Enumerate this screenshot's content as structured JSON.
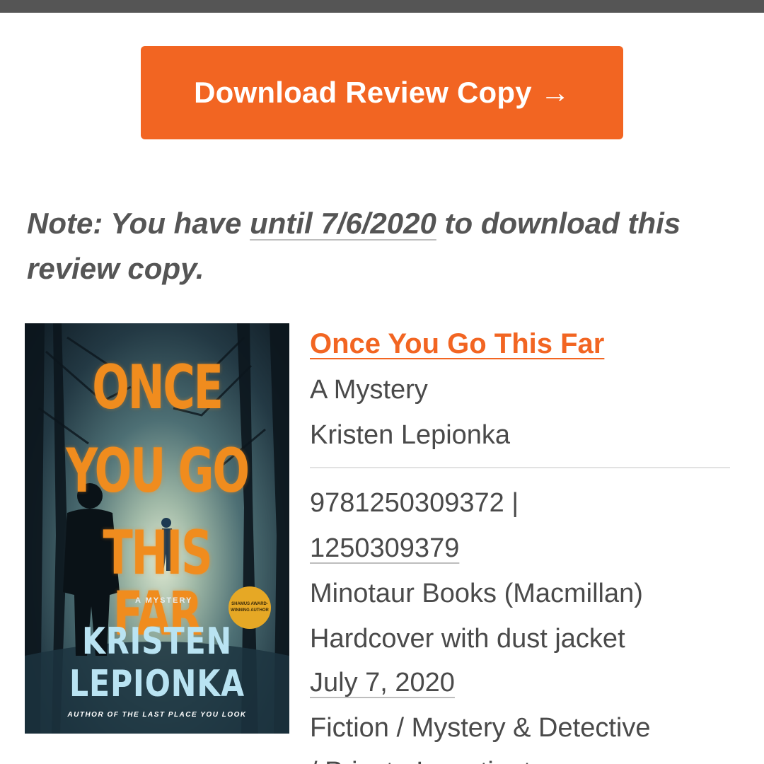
{
  "download_button": {
    "label": "Download Review Copy →"
  },
  "note": {
    "prefix": "Note: You have ",
    "deadline": "until 7/6/2020",
    "suffix": " to download this review copy."
  },
  "cover": {
    "title_line_1": "ONCE",
    "title_line_2": "YOU GO",
    "title_line_3": "THIS FAR",
    "subtitle": "A MYSTERY",
    "badge": "SHAMUS AWARD-WINNING AUTHOR",
    "author_line_1": "KRISTEN",
    "author_line_2": "LEPIONKA",
    "tagline": "AUTHOR OF THE LAST PLACE YOU LOOK"
  },
  "book": {
    "title": "Once You Go This Far",
    "subtitle": "A Mystery",
    "author": "Kristen Lepionka",
    "isbn13": "9781250309372 |",
    "isbn10": "1250309379",
    "publisher": "Minotaur Books (Macmillan)",
    "format": "Hardcover with dust jacket",
    "pub_date": "July 7, 2020",
    "category": "Fiction / Mystery & Detective",
    "category_cont": "/ Private Investigators"
  },
  "colors": {
    "accent": "#f26522",
    "text": "#4a4a4a",
    "note_text": "#555555",
    "top_bar": "#555555"
  }
}
